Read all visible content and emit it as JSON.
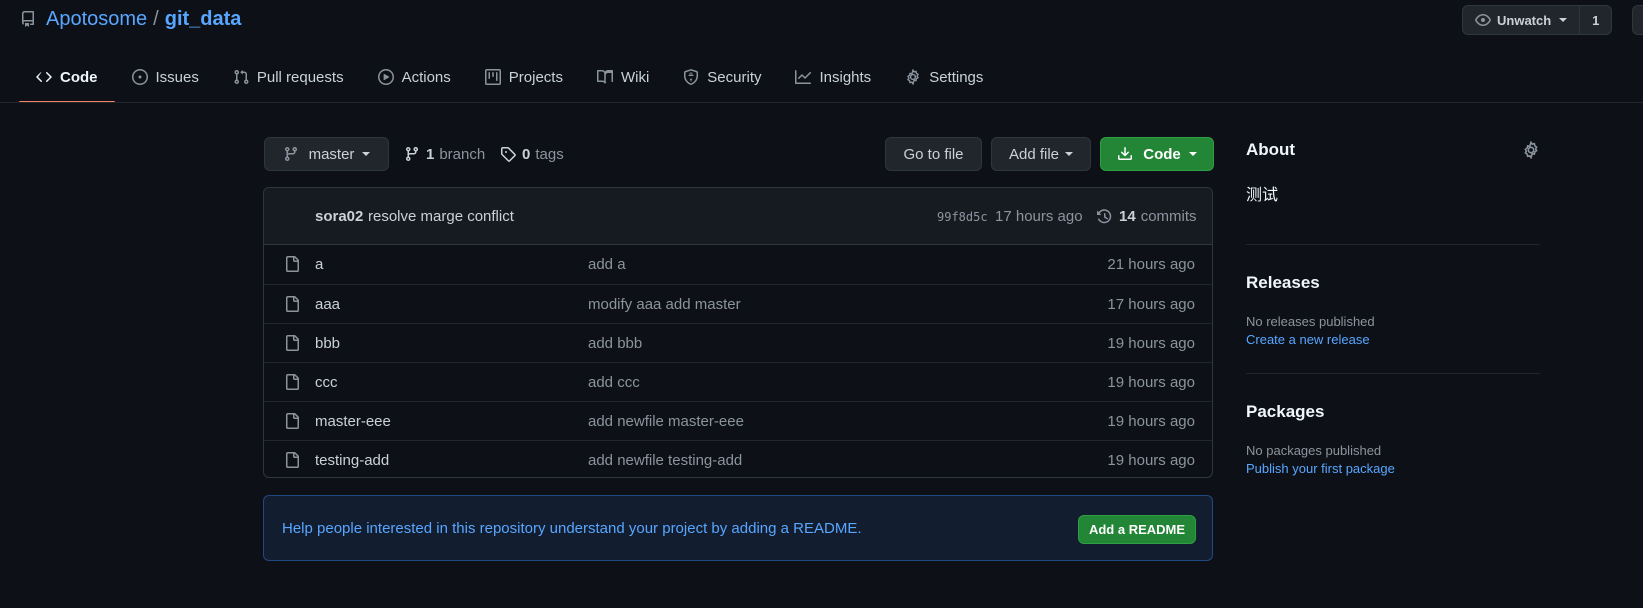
{
  "repo": {
    "owner": "Apotosome",
    "separator": "/",
    "name": "git_data"
  },
  "watch": {
    "label": "Unwatch",
    "count": "1"
  },
  "tabs": [
    {
      "label": "Code",
      "icon": "code-icon",
      "active": true
    },
    {
      "label": "Issues",
      "icon": "issue-icon"
    },
    {
      "label": "Pull requests",
      "icon": "pull-request-icon"
    },
    {
      "label": "Actions",
      "icon": "play-icon"
    },
    {
      "label": "Projects",
      "icon": "project-icon"
    },
    {
      "label": "Wiki",
      "icon": "book-icon"
    },
    {
      "label": "Security",
      "icon": "shield-icon"
    },
    {
      "label": "Insights",
      "icon": "graph-icon"
    },
    {
      "label": "Settings",
      "icon": "gear-icon"
    }
  ],
  "file_nav": {
    "branch": "master",
    "branch_count": "1",
    "branch_label": "branch",
    "tag_count": "0",
    "tag_label": "tags",
    "goto_file": "Go to file",
    "add_file": "Add file",
    "code": "Code"
  },
  "latest_commit": {
    "author": "sora02",
    "message": "resolve marge conflict",
    "sha": "99f8d5c",
    "time": "17 hours ago",
    "count": "14",
    "count_label": "commits"
  },
  "files": [
    {
      "name": "a",
      "commit": "add a",
      "time": "21 hours ago"
    },
    {
      "name": "aaa",
      "commit": "modify aaa add master",
      "time": "17 hours ago"
    },
    {
      "name": "bbb",
      "commit": "add bbb",
      "time": "19 hours ago"
    },
    {
      "name": "ccc",
      "commit": "add ccc",
      "time": "19 hours ago"
    },
    {
      "name": "master-eee",
      "commit": "add newfile master-eee",
      "time": "19 hours ago"
    },
    {
      "name": "testing-add",
      "commit": "add newfile testing-add",
      "time": "19 hours ago"
    }
  ],
  "readme": {
    "text": "Help people interested in this repository understand your project by adding a README.",
    "button": "Add a README"
  },
  "sidebar": {
    "about_title": "About",
    "description": "测试",
    "releases_title": "Releases",
    "releases_empty": "No releases published",
    "releases_link": "Create a new release",
    "packages_title": "Packages",
    "packages_empty": "No packages published",
    "packages_link": "Publish your first package"
  },
  "colors": {
    "background": "#0d1117",
    "link": "#58a6ff",
    "primary_button": "#238636",
    "active_tab_underline": "#f78166"
  }
}
